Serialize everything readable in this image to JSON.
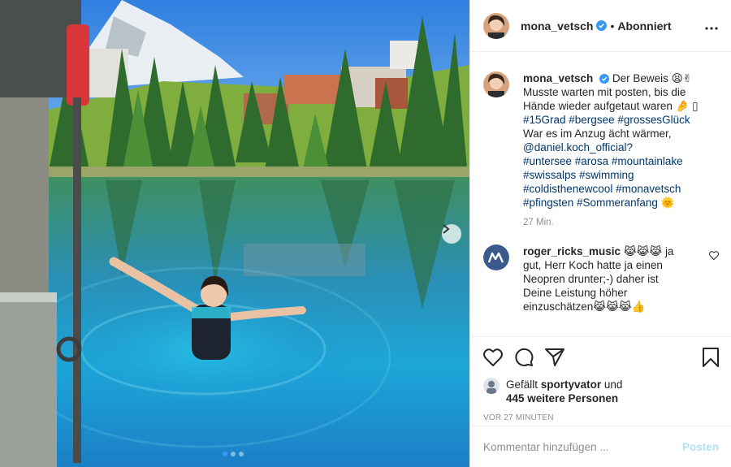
{
  "photo": {
    "alt": "",
    "carousel_count": 3,
    "carousel_active": 0
  },
  "header": {
    "username": "mona_vetsch",
    "separator": "•",
    "follow_status": "Abonniert"
  },
  "caption": {
    "username": "mona_vetsch",
    "text_1": "Der Beweis 😫✌",
    "text_2": "Musste warten mit posten, bis die",
    "text_3": "Hände wieder aufgetaut waren 🤌 ▯",
    "tags_1": "#15Grad #bergsee #grossesGlück",
    "text_4": "War es im Anzug ächt wärmer,",
    "mention": "@daniel.koch_official?",
    "tags_2": "#untersee #arosa #mountainlake",
    "tags_3": "#swissalps #swimming",
    "tags_4": "#coldisthenewcool #monavetsch",
    "tags_5": "#pfingsten #Sommeranfang 🌞",
    "time": "27 Min."
  },
  "comment": {
    "username": "roger_ricks_music",
    "emojis": "😹😹😹",
    "line_1": "ja",
    "line_2": "gut, Herr Koch hatte ja einen",
    "line_3": "Neopren drunter;-) daher ist",
    "line_4": "Deine Leistung höher",
    "line_5": "einzuschätzen😹😹😹👍"
  },
  "likes": {
    "prefix": "Gefällt",
    "user": "sportyvator",
    "connector": "und",
    "others": "445 weitere Personen"
  },
  "timestamp": "VOR 27 MINUTEN",
  "add_comment": {
    "placeholder": "Kommentar hinzufügen ...",
    "post_label": "Posten"
  },
  "colors": {
    "link": "#00376b",
    "verified": "#3897f0",
    "post_disabled": "#b2dffc",
    "muted": "#8e8e8e"
  }
}
